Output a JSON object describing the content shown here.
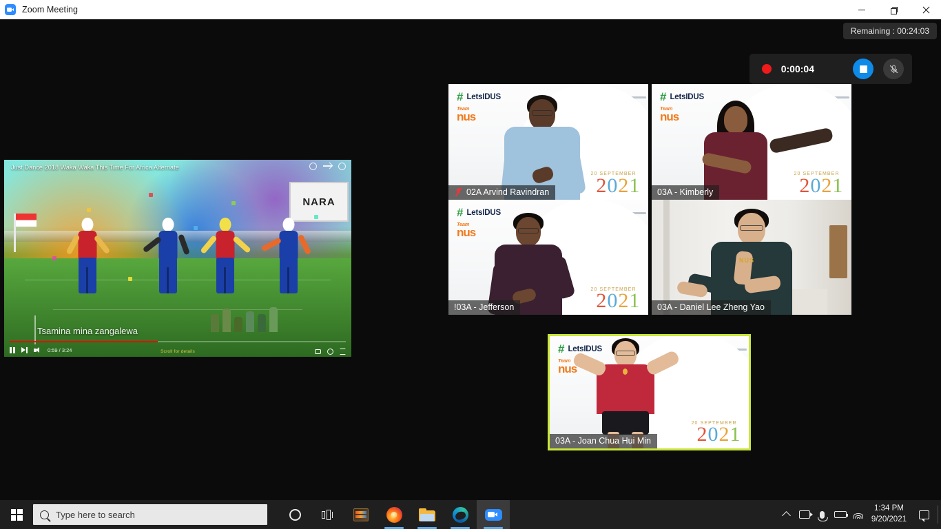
{
  "window": {
    "title": "Zoom Meeting",
    "logo_icon": "zoom-camera-icon",
    "controls": {
      "minimize": "minimize-icon",
      "maximize": "restore-icon",
      "close": "close-icon"
    }
  },
  "meeting": {
    "remaining_label": "Remaining : 00:24:03",
    "recording": {
      "elapsed": "0:00:04",
      "record_dot_icon": "record-dot-icon",
      "stop_icon": "stop-recording-icon",
      "mic_icon": "microphone-muted-icon"
    }
  },
  "shared_screen": {
    "app": "youtube-video",
    "video_title": "Just Dance 2018 Waka Waka This Time For Africa Alternate",
    "lyric": "Tsamina mina zangalewa",
    "time_display": "0:59 / 3:24",
    "scroll_hint": "Scroll for details",
    "banner_text": "NARA",
    "progress_percent": 44,
    "top_icons": [
      "watch-later-icon",
      "share-icon",
      "info-icon"
    ],
    "controls": [
      "pause-button",
      "next-button",
      "volume-button",
      "subtitles-button",
      "settings-button",
      "fullscreen-button"
    ]
  },
  "participants": [
    {
      "id": "arvind",
      "name": "02A Arvind Ravindran",
      "muted": true,
      "active_speaker": false,
      "virtual_background": true,
      "bg_brand_hash": "LetsIDUS",
      "bg_brand_team": "Team",
      "bg_brand_nus": "nus",
      "bg_date": "20 SEPTEMBER",
      "bg_year": "2021",
      "shirt_color": "#9fc2dd",
      "skin_color": "#5a3b2a",
      "hair_color": "#17110d"
    },
    {
      "id": "kimberly",
      "name": "03A - Kimberly",
      "muted": false,
      "active_speaker": false,
      "virtual_background": true,
      "bg_brand_hash": "LetsIDUS",
      "bg_brand_team": "Team",
      "bg_brand_nus": "nus",
      "bg_date": "20 SEPTEMBER",
      "bg_year": "2021",
      "shirt_color": "#6b2230",
      "skin_color": "#8a5c3e",
      "hair_color": "#120d0a"
    },
    {
      "id": "jefferson",
      "name": "!03A - Jefferson",
      "muted": false,
      "active_speaker": false,
      "virtual_background": true,
      "bg_brand_hash": "LetsIDUS",
      "bg_brand_team": "Team",
      "bg_brand_nus": "nus",
      "bg_date": "20 SEPTEMBER",
      "bg_year": "2021",
      "shirt_color": "#3a2030",
      "skin_color": "#6b4630",
      "hair_color": "#100c09"
    },
    {
      "id": "daniel",
      "name": "03A - Daniel Lee Zheng Yao",
      "muted": false,
      "active_speaker": false,
      "virtual_background": false,
      "shirt_color": "#25383a",
      "skin_color": "#d8b08c",
      "hair_color": "#120d0a"
    },
    {
      "id": "joan",
      "name": "03A - Joan Chua Hui Min",
      "muted": false,
      "active_speaker": true,
      "virtual_background": true,
      "bg_brand_hash": "LetsIDUS",
      "bg_brand_team": "Team",
      "bg_brand_nus": "nus",
      "bg_date": "20 SEPTEMBER",
      "bg_year": "2021",
      "shirt_color": "#c0283c",
      "skin_color": "#e3bb98",
      "hair_color": "#120d0a"
    }
  ],
  "colors": {
    "active_speaker_border": "#c9e639",
    "zoom_blue": "#2d8cff",
    "record_red": "#f01a1a",
    "youtube_red": "#ff0000"
  },
  "taskbar": {
    "start_icon": "windows-start-icon",
    "search_placeholder": "Type here to search",
    "apps": [
      {
        "name": "cortana-icon",
        "running": false,
        "active": false
      },
      {
        "name": "task-view-icon",
        "running": false,
        "active": false
      },
      {
        "name": "movie-maker-icon",
        "running": false,
        "active": false
      },
      {
        "name": "firefox-icon",
        "running": true,
        "active": false
      },
      {
        "name": "file-explorer-icon",
        "running": true,
        "active": false
      },
      {
        "name": "microsoft-edge-icon",
        "running": true,
        "active": false
      },
      {
        "name": "zoom-icon",
        "running": true,
        "active": true
      }
    ],
    "tray": {
      "overflow_icon": "chevron-up-icon",
      "camera_icon": "camera-icon",
      "microphone_icon": "microphone-icon",
      "battery_icon": "battery-icon",
      "network_icon": "wifi-icon",
      "time": "1:34 PM",
      "date": "9/20/2021",
      "action_center_icon": "action-center-icon"
    }
  }
}
